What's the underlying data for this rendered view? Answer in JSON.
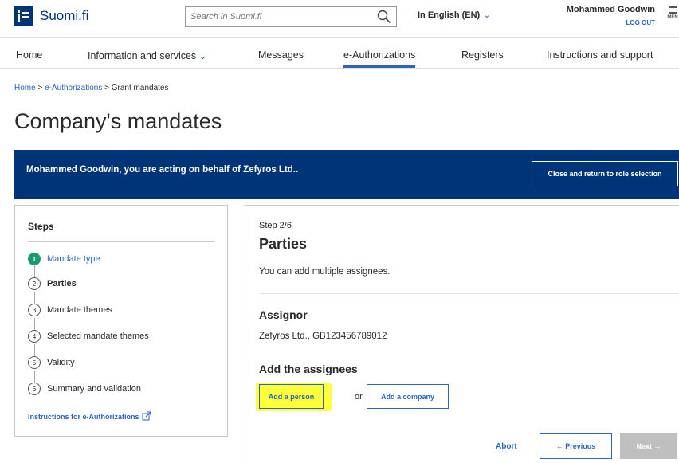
{
  "header": {
    "logo_text": "Suomi.fi",
    "search_placeholder": "Search in Suomi.fi",
    "language": "In English (EN)",
    "user_name": "Mohammed Goodwin",
    "logout": "LOG OUT",
    "menu_label": "MEN"
  },
  "nav": {
    "home": "Home",
    "info": "Information and services",
    "messages": "Messages",
    "eauth": "e-Authorizations",
    "registers": "Registers",
    "instructions": "Instructions and support"
  },
  "breadcrumb": {
    "home": "Home",
    "eauth": "e-Authorizations",
    "current": "Grant mandates",
    "sep": ">"
  },
  "page_title": "Company's mandates",
  "banner": {
    "text": "Mohammed Goodwin, you are acting on behalf of Zefyros Ltd..",
    "button": "Close and return to role selection"
  },
  "steps": {
    "title": "Steps",
    "items": [
      {
        "num": "1",
        "label": "Mandate type"
      },
      {
        "num": "2",
        "label": "Parties"
      },
      {
        "num": "3",
        "label": "Mandate themes"
      },
      {
        "num": "4",
        "label": "Selected mandate themes"
      },
      {
        "num": "5",
        "label": "Validity"
      },
      {
        "num": "6",
        "label": "Summary and validation"
      }
    ],
    "instructions_link": "Instructions for e-Authorizations"
  },
  "main": {
    "step_label": "Step 2/6",
    "title": "Parties",
    "hint": "You can add multiple assignees.",
    "assignor_heading": "Assignor",
    "assignor_value": "Zefyros Ltd., GB123456789012",
    "assignees_heading": "Add the assignees",
    "add_person": "Add a person",
    "or": "or",
    "add_company": "Add a company",
    "abort": "Abort",
    "previous": "← Previous",
    "next": "Next →"
  },
  "colors": {
    "brand": "#003479",
    "link": "#2a64c5",
    "done": "#1a9b6c",
    "highlight": "#ffff3a"
  }
}
